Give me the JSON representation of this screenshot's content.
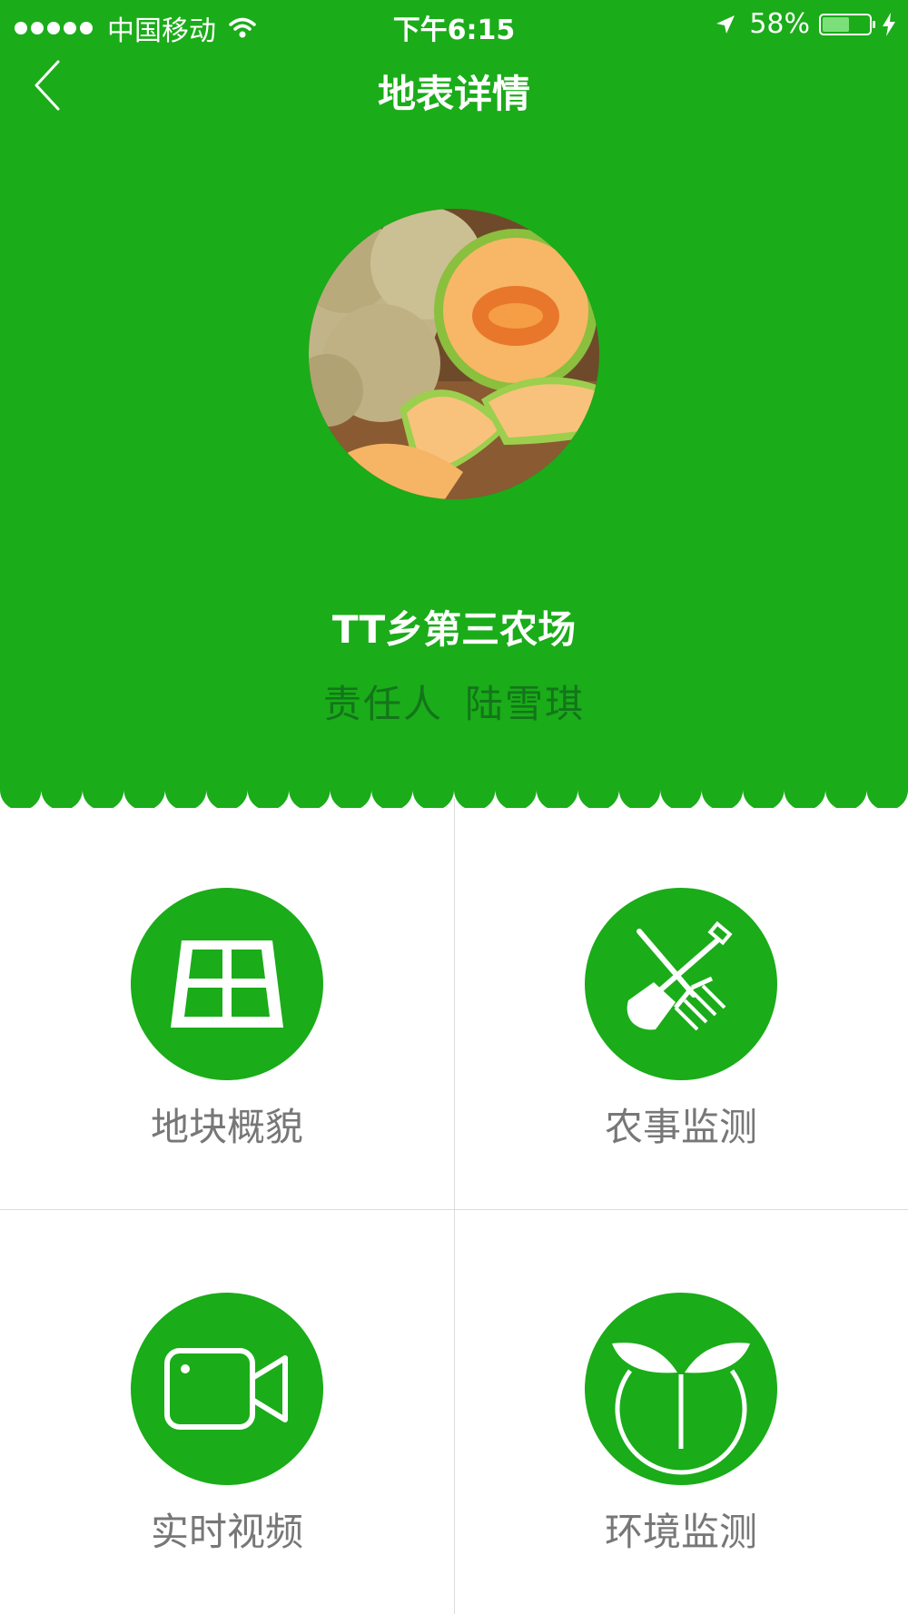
{
  "status_bar": {
    "carrier": "中国移动",
    "time": "下午6:15",
    "battery_percent_text": "58%",
    "battery_level": 0.58
  },
  "nav": {
    "title": "地表详情",
    "back_icon": "chevron-left-icon"
  },
  "farm": {
    "name": "TT乡第三农场",
    "owner_label": "责任人",
    "owner_name": "陆雪琪"
  },
  "menu": [
    {
      "label": "地块概貌",
      "icon": "plot-grid-icon"
    },
    {
      "label": "农事监测",
      "icon": "shovel-fork-icon"
    },
    {
      "label": "实时视频",
      "icon": "video-camera-icon"
    },
    {
      "label": "环境监测",
      "icon": "sprout-icon"
    }
  ],
  "colors": {
    "brand_green": "#1aac19",
    "owner_text": "#13751a",
    "label_gray": "#777777"
  }
}
